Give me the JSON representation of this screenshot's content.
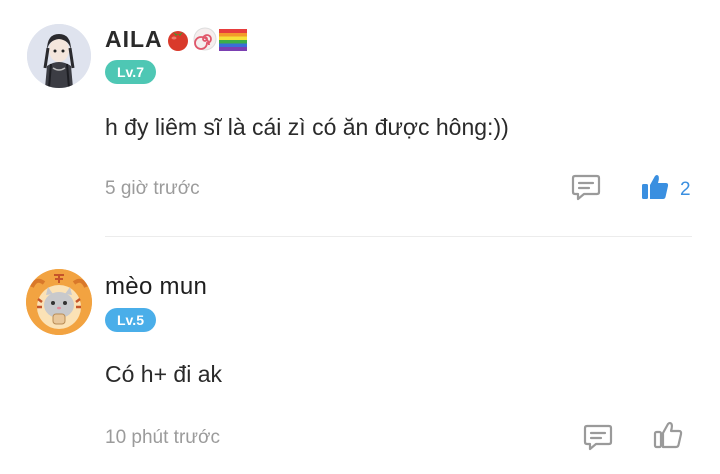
{
  "comments": [
    {
      "username": "AILA",
      "username_emojis": [
        "tomato-icon",
        "swirl-candy-icon",
        "rainbow-flag-icon"
      ],
      "level": "Lv.7",
      "level_color": "#4ec7b4",
      "text": "h đy  liêm sĩ là cái zì có ăn được hông:))",
      "time": "5 giờ trước",
      "reply_icon": "comment-icon",
      "like_icon": "thumbs-up-filled-icon",
      "liked": true,
      "like_count": "2"
    },
    {
      "username": "mèo mun",
      "level": "Lv.5",
      "level_color": "#4aaee9",
      "text": "Có h+ đi ak",
      "time": "10 phút trước",
      "reply_icon": "comment-icon",
      "like_icon": "thumbs-up-outline-icon",
      "liked": false
    }
  ],
  "colors": {
    "accent_like": "#3a8fe0",
    "timestamp": "#9b9b9b",
    "icon_gray": "#9a9a9a"
  }
}
